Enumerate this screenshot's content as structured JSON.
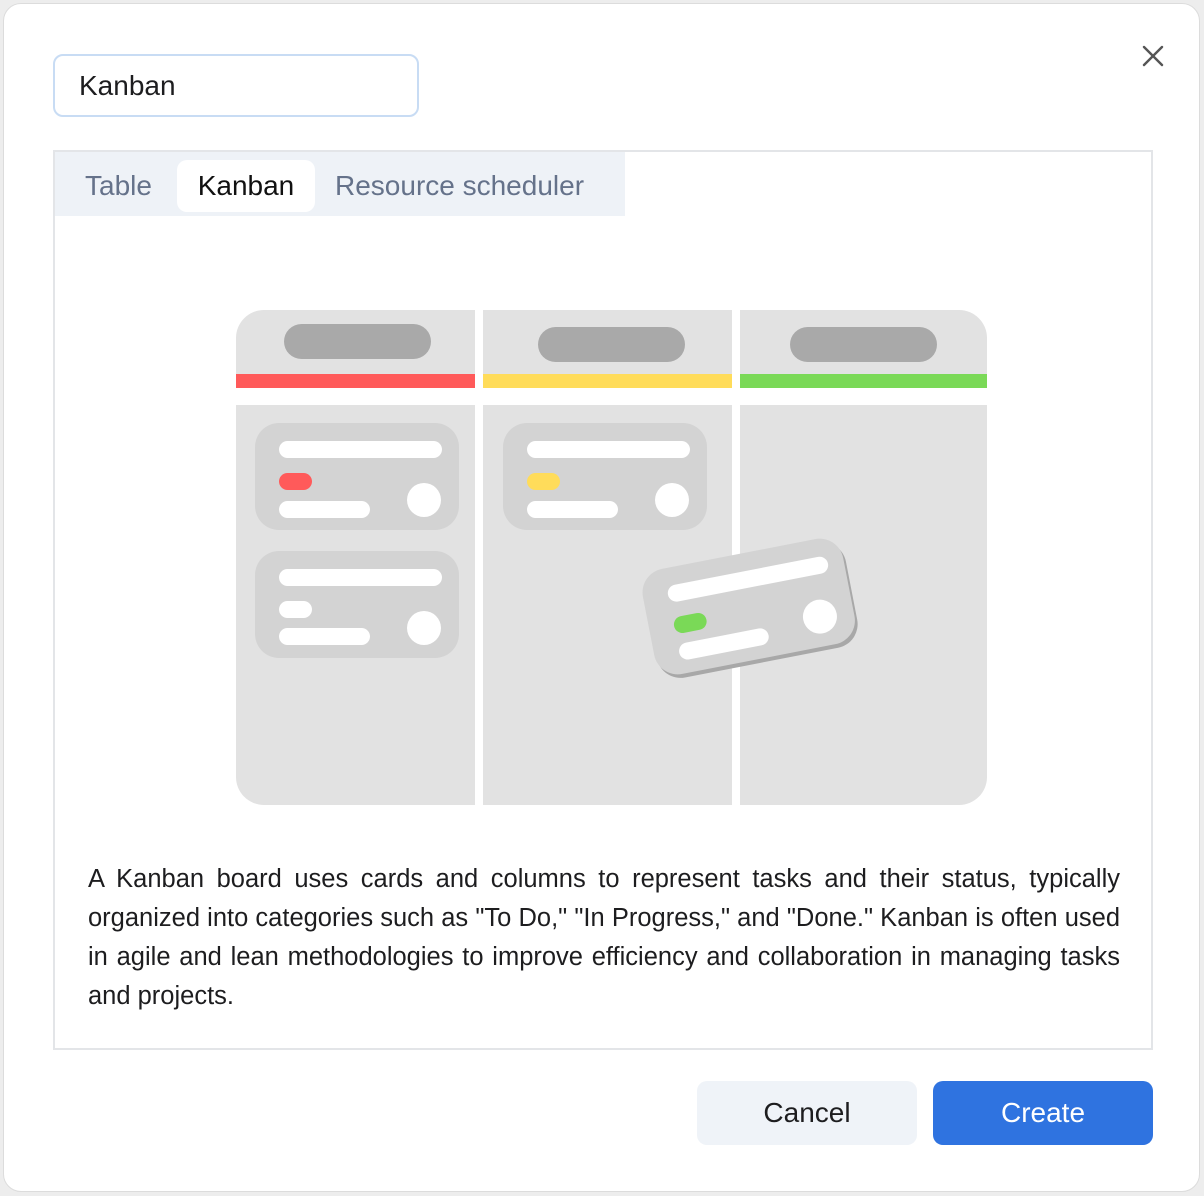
{
  "dialog": {
    "name_input": {
      "value": "Kanban",
      "placeholder": ""
    },
    "close_icon": "close-icon"
  },
  "tabs": [
    {
      "label": "Table",
      "active": false
    },
    {
      "label": "Kanban",
      "active": true
    },
    {
      "label": "Resource scheduler",
      "active": false
    }
  ],
  "illustration": {
    "column_colors": [
      "#ff5a5a",
      "#ffdc5a",
      "#7ad957"
    ]
  },
  "description": "A Kanban board uses cards and columns to represent tasks and their status, typically organized into categories such as \"To Do,\" \"In Progress,\" and \"Done.\" Kanban is often used in agile and lean methodologies to improve efficiency and collaboration in managing tasks and projects.",
  "footer": {
    "cancel_label": "Cancel",
    "create_label": "Create"
  },
  "colors": {
    "primary": "#2f73e0",
    "tab_bar": "#eef2f7"
  }
}
